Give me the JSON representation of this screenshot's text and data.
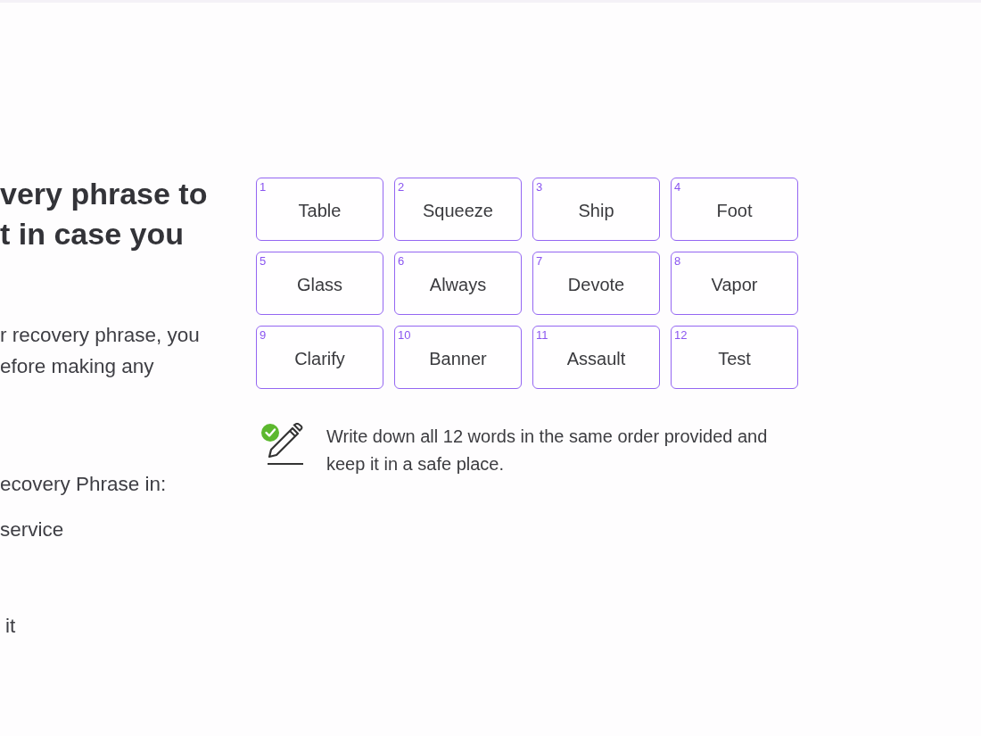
{
  "intro": {
    "heading_lines": [
      "very phrase to",
      "t in case you"
    ],
    "body_lines": [
      "r recovery phrase, you",
      "efore making any"
    ]
  },
  "storage": {
    "label": "ecovery Phrase in:",
    "items": [
      "service",
      "it"
    ]
  },
  "phrase": {
    "words": [
      {
        "index": "1",
        "word": "Table"
      },
      {
        "index": "2",
        "word": "Squeeze"
      },
      {
        "index": "3",
        "word": "Ship"
      },
      {
        "index": "4",
        "word": "Foot"
      },
      {
        "index": "5",
        "word": "Glass"
      },
      {
        "index": "6",
        "word": "Always"
      },
      {
        "index": "7",
        "word": "Devote"
      },
      {
        "index": "8",
        "word": "Vapor"
      },
      {
        "index": "9",
        "word": "Clarify"
      },
      {
        "index": "10",
        "word": "Banner"
      },
      {
        "index": "11",
        "word": "Assault"
      },
      {
        "index": "12",
        "word": "Test"
      }
    ]
  },
  "note": {
    "text": "Write down all 12 words in the same order provided and keep it in a safe place."
  }
}
